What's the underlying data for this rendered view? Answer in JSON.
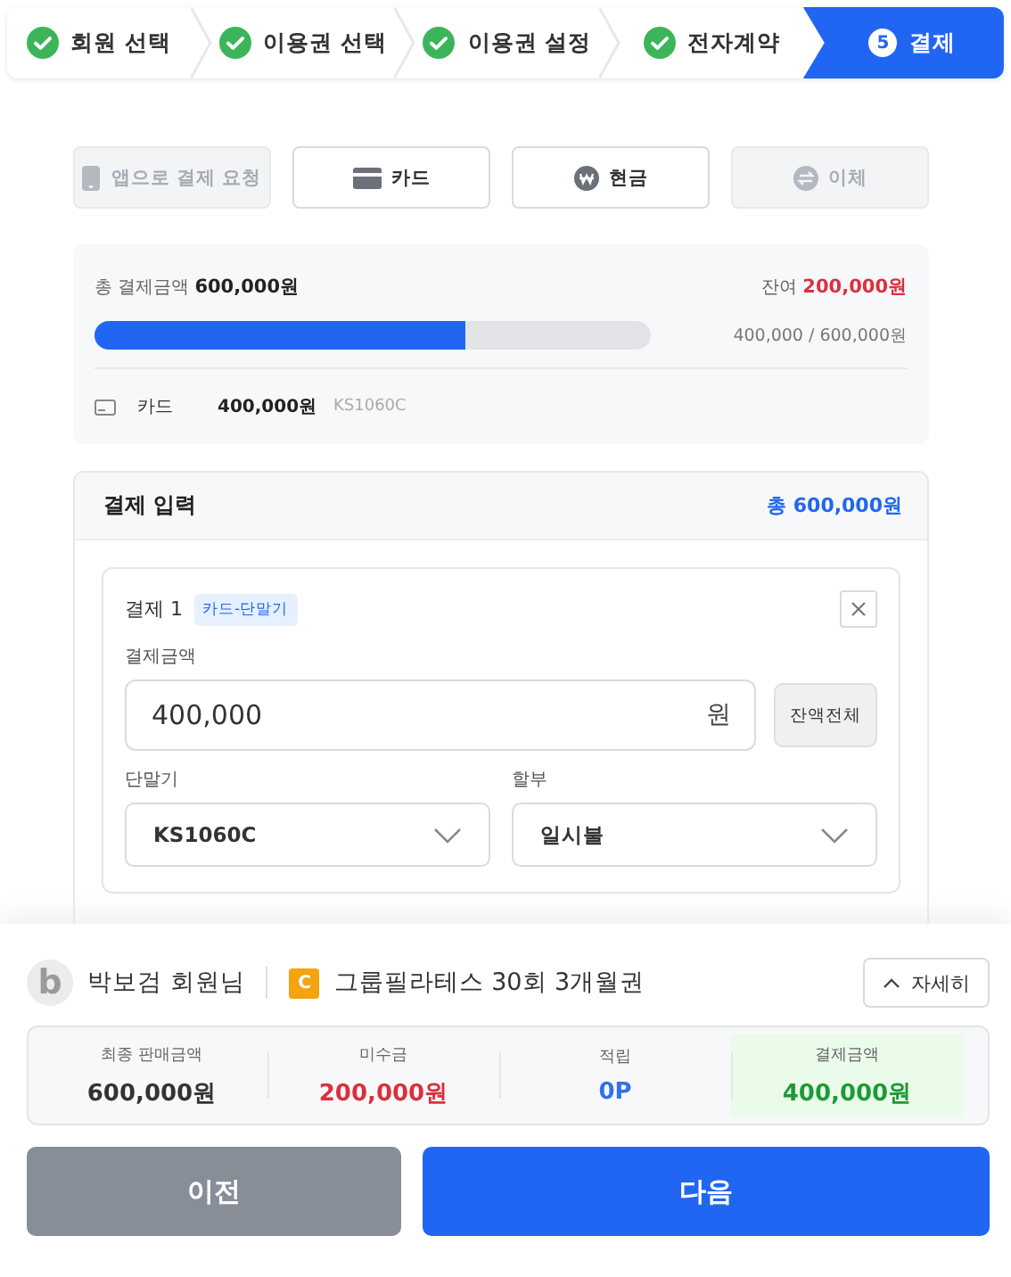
{
  "steps": [
    {
      "label": "회원 선택",
      "completed": true,
      "selected": false
    },
    {
      "label": "이용권 선택",
      "completed": true,
      "selected": false
    },
    {
      "label": "이용권 설정",
      "completed": true,
      "selected": false
    },
    {
      "label": "전자계약",
      "completed": true,
      "selected": false
    },
    {
      "number": "5",
      "label": "결제",
      "completed": false,
      "selected": true
    }
  ],
  "payment_methods": [
    {
      "label": "앱으로 결제 요청",
      "kind": "phone",
      "disabled": true
    },
    {
      "label": "카드",
      "kind": "card",
      "disabled": false
    },
    {
      "label": "현금",
      "kind": "cash",
      "disabled": false
    },
    {
      "label": "이체",
      "kind": "transfer",
      "disabled": true
    }
  ],
  "summary": {
    "total_label": "총 결제금액",
    "total": "600,000원",
    "remaining_label": "잔여",
    "remaining": "200,000원",
    "progress": {
      "level": 0.667,
      "reading": "400,000 / 600,000원"
    },
    "payments": [
      {
        "kind": "card",
        "method": "카드",
        "amount": "400,000원",
        "terminal": "KS1060C"
      }
    ]
  },
  "payment_input": {
    "title": "결제 입력",
    "total": "총 600,000원",
    "entries": [
      {
        "title": "결제 1",
        "tag": "카드-단말기",
        "amount_label": "결제금액",
        "amount": "400,000",
        "unit": "원",
        "fill_button": "잔액전체",
        "terminal_label": "단말기",
        "terminal": "KS1060C",
        "installment_label": "할부",
        "installment": "일시불"
      }
    ]
  },
  "member": {
    "avatar": "b",
    "name": "박보검 회원님",
    "product_badge": "C",
    "product": "그룹필라테스 30회 3개월권",
    "details_button": "자세히"
  },
  "totals": [
    {
      "label": "최종 판매금액",
      "value": "600,000원",
      "color": "#333333",
      "highlighted": false
    },
    {
      "label": "미수금",
      "value": "200,000원",
      "color": "#dc2f3d",
      "highlighted": false
    },
    {
      "label": "적립",
      "value": "0P",
      "color": "#2f6ff0",
      "highlighted": false
    },
    {
      "label": "결제금액",
      "value": "400,000원",
      "color": "#1e9a37",
      "highlighted": true
    }
  ],
  "buttons": [
    {
      "label": "이전",
      "kind": "secondary"
    },
    {
      "label": "다음",
      "kind": "primary"
    }
  ]
}
